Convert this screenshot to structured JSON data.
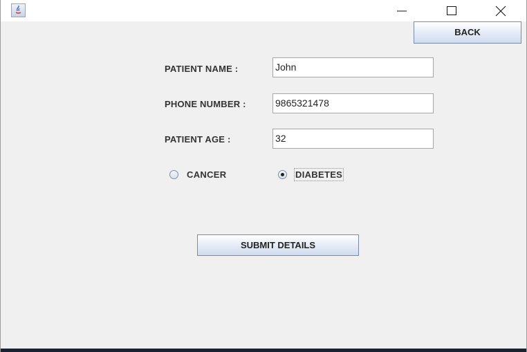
{
  "window": {
    "controls": {
      "minimize_icon": "minimize-icon",
      "maximize_icon": "maximize-icon",
      "close_icon": "close-icon"
    },
    "app_icon": "java-app-icon"
  },
  "header": {
    "back_label": "BACK"
  },
  "form": {
    "patient_name": {
      "label": "PATIENT NAME :",
      "value": "John"
    },
    "phone_number": {
      "label": "PHONE NUMBER :",
      "value": "9865321478"
    },
    "patient_age": {
      "label": "PATIENT AGE :",
      "value": "32"
    },
    "disease": {
      "options": [
        {
          "label": "CANCER",
          "selected": false
        },
        {
          "label": "DIABETES",
          "selected": true
        }
      ]
    },
    "submit_label": "SUBMIT DETAILS"
  },
  "colors": {
    "background": "#f0f0f0",
    "button_border": "#7a8aa8"
  }
}
